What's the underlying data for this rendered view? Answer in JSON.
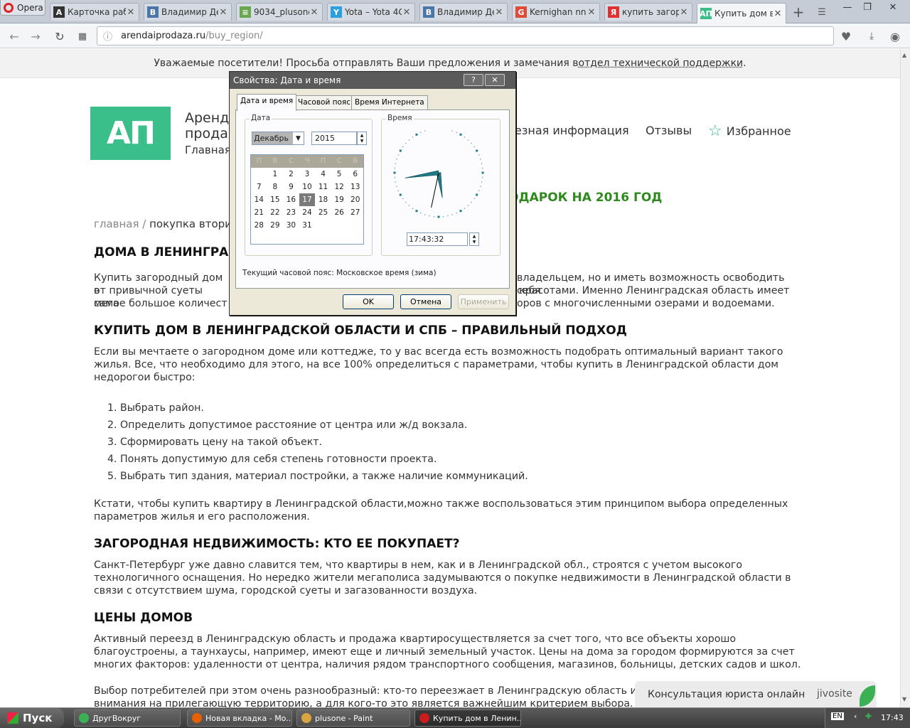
{
  "browser": {
    "opera_label": "Opera",
    "tabs": [
      {
        "title": "Карточка рабо",
        "icon": "A",
        "icon_color": "#333333"
      },
      {
        "title": "Владимир Дем",
        "icon": "B",
        "icon_color": "#4a76a8"
      },
      {
        "title": "9034_plusone -",
        "icon": "≡",
        "icon_color": "#6aa84f"
      },
      {
        "title": "Yota – Yota 4G",
        "icon": "Y",
        "icon_color": "#2aa0e0"
      },
      {
        "title": "Владимир Дем",
        "icon": "B",
        "icon_color": "#4a76a8"
      },
      {
        "title": "Kernighan nn –",
        "icon": "G",
        "icon_color": "#dd4b39"
      },
      {
        "title": "купить загоро",
        "icon": "Я",
        "icon_color": "#e23030"
      },
      {
        "title": "Купить дом в Л",
        "icon": "АП",
        "icon_color": "#3bbf8a"
      }
    ],
    "url_host": "arendaiprodaza.ru",
    "url_path": "/buy_region/"
  },
  "notice": {
    "text": "Уважаемые посетители! Просьба отправлять Ваши предложения и замечания в",
    "link": "отдел технической поддержки",
    "tail": "."
  },
  "site": {
    "logo": "АП",
    "brand_line1": "Аренд",
    "brand_line2": "продаж",
    "brand_sub": "Главная",
    "nav": [
      "езная информация",
      "Отзывы",
      "Избранное"
    ],
    "promo": "ОДАРОК НА 2016 ГОД",
    "breadcrumb_home": "главная",
    "breadcrumb_sep": " / ",
    "breadcrumb_current": "покупка вторич"
  },
  "content": {
    "h1": "ДОМА В ЛЕНИНГРА",
    "intro_l1a": "Купить загородный дом в",
    "intro_l1b": "владельцем, но и иметь возможность освободить себя",
    "intro_l2a": "от привычной суеты мега",
    "intro_l2b": "красотами. Именно Ленинградская область имеет",
    "intro_l3a": "самое большое количест",
    "intro_l3b": "оров с многочисленными озерами и водоемами.",
    "h2": "КУПИТЬ ДОМ В ЛЕНИНГРАДСКОЙ ОБЛАСТИ И СПБ – ПРАВИЛЬНЫЙ ПОДХОД",
    "p2": "Если вы мечтаете о загородном доме или коттедже, то у вас всегда есть возможность подобрать оптимальный вариант такого жилья. Все, что необходимо для этого, на все 100% определиться с параметрами, чтобы купить в Ленинградской области дом недорогои быстро:",
    "steps": [
      "Выбрать район.",
      "Определить допустимое расстояние от центра или ж/д вокзала.",
      "Сформировать цену на такой объект.",
      "Понять допустимую для себя степень готовности проекта.",
      "Выбрать тип здания, материал постройки, а также наличие коммуникаций."
    ],
    "p3": "Кстати, чтобы купить квартиру в Ленинградской области,можно также воспользоваться этим принципом выбора определенных параметров жилья и его расположения.",
    "h3": "ЗАГОРОДНАЯ НЕДВИЖИМОСТЬ: КТО ЕЕ ПОКУПАЕТ?",
    "p4": "Санкт-Петербург уже давно славится тем, что квартиры в нем, как и в Ленинградской обл., строятся с учетом высокого технологичного оснащения. Но нередко жители мегаполиса задумываются о покупке недвижимости в Ленинградской области в связи с отсутствием шума, городской суеты и загазованности воздуха.",
    "h4": "ЦЕНЫ ДОМОВ",
    "p5": "Активный переезд в Ленинградскую область и продажа квартиросуществляется за счет того, что все объекты хорошо благоустроены, а таунхаусы, например, имеют еще и личный земельный участок. Цены на дома за городом формируются за счет многих факторов: удаленности от центра, наличия рядом транспортного сообщения, магазинов, больницы, детских садов и школ.",
    "p6": "Выбор потребителей при этом очень разнообразный: кто-то переезжает в Ленинградскую область и по",
    "p6b": "внимания на прилегающую территорию, а для кого-то это является важнейшим критерием выбора. В л"
  },
  "jivo": {
    "text": "Консультация юриста онлайн",
    "brand": "jivosite"
  },
  "dialog": {
    "title": "Свойства: Дата и время",
    "help": "?",
    "close": "✕",
    "tabs": [
      "Дата и время",
      "Часовой пояс",
      "Время Интернета"
    ],
    "date_label": "Дата",
    "time_label": "Время",
    "month": "Декабрь",
    "year": "2015",
    "weekdays": [
      "П",
      "В",
      "С",
      "Ч",
      "П",
      "С",
      "В"
    ],
    "days": [
      "",
      "1",
      "2",
      "3",
      "4",
      "5",
      "6",
      "7",
      "8",
      "9",
      "10",
      "11",
      "12",
      "13",
      "14",
      "15",
      "16",
      "17",
      "18",
      "19",
      "20",
      "21",
      "22",
      "23",
      "24",
      "25",
      "26",
      "27",
      "28",
      "29",
      "30",
      "31"
    ],
    "selected_day": "17",
    "time": "17:43:32",
    "clock": {
      "hour": 17,
      "minute": 43,
      "second": 32
    },
    "timezone_text": "Текущий часовой пояс: Московское время (зима)",
    "ok": "OK",
    "cancel": "Отмена",
    "apply": "Применить"
  },
  "taskbar": {
    "start": "Пуск",
    "items": [
      {
        "label": "ДругВокруг",
        "icon_color": "#3cb054"
      },
      {
        "label": "Новая вкладка - Mo...",
        "icon_color": "#e66000"
      },
      {
        "label": "plusone - Paint",
        "icon_color": "#d9a441"
      },
      {
        "label": "Купить дом в Ленин...",
        "icon_color": "#cc1b1b"
      }
    ],
    "lang": "EN",
    "clock": "17:43"
  }
}
